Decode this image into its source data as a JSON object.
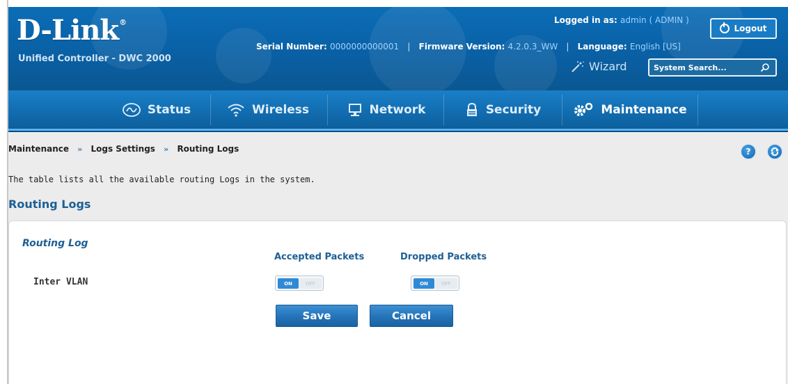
{
  "header": {
    "brand_name": "D-Link",
    "brand_mark": "®",
    "subtitle": "Unified Controller - DWC 2000",
    "logged_in_label": "Logged in as:",
    "logged_in_value": "admin ( ADMIN )",
    "logout_label": "Logout",
    "serial_label": "Serial Number:",
    "serial_value": "0000000000001",
    "firmware_label": "Firmware Version:",
    "firmware_value": "4.2.0.3_WW",
    "language_label": "Language:",
    "language_value": "English [US]",
    "wizard_label": "Wizard",
    "search_placeholder": "System Search..."
  },
  "nav": {
    "items": [
      {
        "label": "Status",
        "icon": "status-icon"
      },
      {
        "label": "Wireless",
        "icon": "wifi-icon"
      },
      {
        "label": "Network",
        "icon": "network-icon"
      },
      {
        "label": "Security",
        "icon": "lock-icon"
      },
      {
        "label": "Maintenance",
        "icon": "gear-icon",
        "active": true
      }
    ]
  },
  "breadcrumb": {
    "items": [
      "Maintenance",
      "Logs Settings",
      "Routing Logs"
    ],
    "separator": "»"
  },
  "page": {
    "description": "The table lists all the available routing Logs in the system.",
    "heading": "Routing Logs",
    "section_title": "Routing Log",
    "columns": [
      "Accepted Packets",
      "Dropped Packets"
    ],
    "row_label": "Inter VLAN",
    "toggle_on": "ON",
    "toggle_off": "OFF",
    "toggle_states": {
      "accepted": true,
      "dropped": true
    },
    "save_label": "Save",
    "cancel_label": "Cancel"
  },
  "colors": {
    "header_blue": "#0a5fa3",
    "nav_blue": "#126db0",
    "accent_text": "#1d5f95",
    "button_blue": "#2473b8"
  }
}
